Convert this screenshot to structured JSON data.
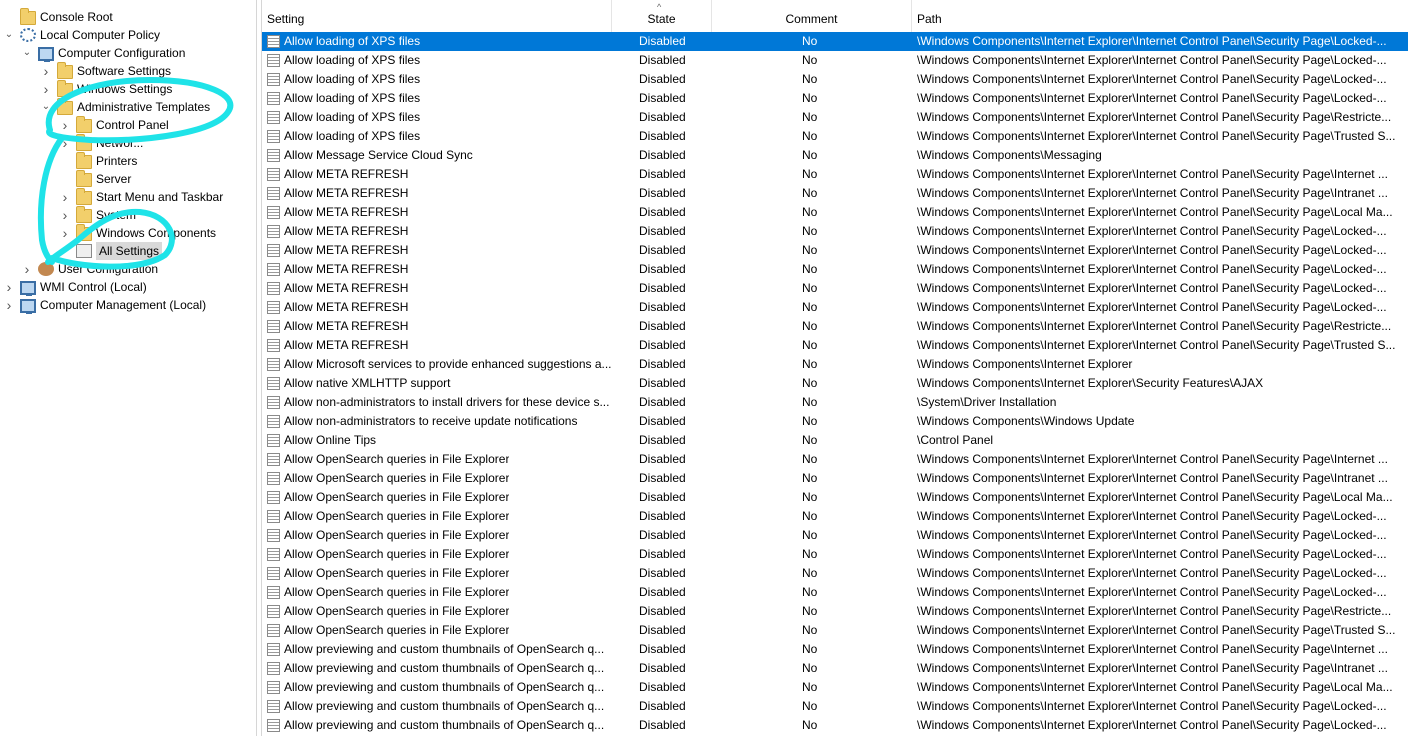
{
  "tree": {
    "nodes": [
      {
        "label": "Console Root",
        "icon": "folder-icon",
        "expand": ""
      },
      {
        "label": "Local Computer Policy",
        "icon": "gear-icon",
        "expand": "v"
      },
      {
        "label": "Computer Configuration",
        "icon": "computer-icon",
        "expand": "v"
      },
      {
        "label": "Software Settings",
        "icon": "folder-icon",
        "expand": ">"
      },
      {
        "label": "Windows Settings",
        "icon": "folder-icon",
        "expand": ">"
      },
      {
        "label": "Administrative Templates",
        "icon": "folder-icon",
        "expand": "v"
      },
      {
        "label": "Control Panel",
        "icon": "folder-icon",
        "expand": ">"
      },
      {
        "label": "Networ...",
        "icon": "folder-icon",
        "expand": ">"
      },
      {
        "label": "Printers",
        "icon": "folder-icon",
        "expand": ""
      },
      {
        "label": "Server",
        "icon": "folder-icon",
        "expand": ""
      },
      {
        "label": "Start Menu and Taskbar",
        "icon": "folder-icon",
        "expand": ">"
      },
      {
        "label": "System",
        "icon": "folder-icon",
        "expand": ">"
      },
      {
        "label": "Windows Components",
        "icon": "folder-icon",
        "expand": ">"
      },
      {
        "label": "All Settings",
        "icon": "settings-icon",
        "expand": ""
      },
      {
        "label": "User Configuration",
        "icon": "user-icon",
        "expand": ">"
      },
      {
        "label": "WMI Control (Local)",
        "icon": "computer-icon",
        "expand": ">"
      },
      {
        "label": "Computer Management (Local)",
        "icon": "computer-icon",
        "expand": ">"
      }
    ]
  },
  "list": {
    "columns": {
      "setting": "Setting",
      "state": "State",
      "comment": "Comment",
      "path": "Path"
    },
    "rows": [
      {
        "setting": "Allow loading of XPS files",
        "state": "Disabled",
        "comment": "No",
        "path": "\\Windows Components\\Internet Explorer\\Internet Control Panel\\Security Page\\Locked-..."
      },
      {
        "setting": "Allow loading of XPS files",
        "state": "Disabled",
        "comment": "No",
        "path": "\\Windows Components\\Internet Explorer\\Internet Control Panel\\Security Page\\Locked-..."
      },
      {
        "setting": "Allow loading of XPS files",
        "state": "Disabled",
        "comment": "No",
        "path": "\\Windows Components\\Internet Explorer\\Internet Control Panel\\Security Page\\Locked-..."
      },
      {
        "setting": "Allow loading of XPS files",
        "state": "Disabled",
        "comment": "No",
        "path": "\\Windows Components\\Internet Explorer\\Internet Control Panel\\Security Page\\Locked-..."
      },
      {
        "setting": "Allow loading of XPS files",
        "state": "Disabled",
        "comment": "No",
        "path": "\\Windows Components\\Internet Explorer\\Internet Control Panel\\Security Page\\Restricte..."
      },
      {
        "setting": "Allow loading of XPS files",
        "state": "Disabled",
        "comment": "No",
        "path": "\\Windows Components\\Internet Explorer\\Internet Control Panel\\Security Page\\Trusted S..."
      },
      {
        "setting": "Allow Message Service Cloud Sync",
        "state": "Disabled",
        "comment": "No",
        "path": "\\Windows Components\\Messaging"
      },
      {
        "setting": "Allow META REFRESH",
        "state": "Disabled",
        "comment": "No",
        "path": "\\Windows Components\\Internet Explorer\\Internet Control Panel\\Security Page\\Internet ..."
      },
      {
        "setting": "Allow META REFRESH",
        "state": "Disabled",
        "comment": "No",
        "path": "\\Windows Components\\Internet Explorer\\Internet Control Panel\\Security Page\\Intranet ..."
      },
      {
        "setting": "Allow META REFRESH",
        "state": "Disabled",
        "comment": "No",
        "path": "\\Windows Components\\Internet Explorer\\Internet Control Panel\\Security Page\\Local Ma..."
      },
      {
        "setting": "Allow META REFRESH",
        "state": "Disabled",
        "comment": "No",
        "path": "\\Windows Components\\Internet Explorer\\Internet Control Panel\\Security Page\\Locked-..."
      },
      {
        "setting": "Allow META REFRESH",
        "state": "Disabled",
        "comment": "No",
        "path": "\\Windows Components\\Internet Explorer\\Internet Control Panel\\Security Page\\Locked-..."
      },
      {
        "setting": "Allow META REFRESH",
        "state": "Disabled",
        "comment": "No",
        "path": "\\Windows Components\\Internet Explorer\\Internet Control Panel\\Security Page\\Locked-..."
      },
      {
        "setting": "Allow META REFRESH",
        "state": "Disabled",
        "comment": "No",
        "path": "\\Windows Components\\Internet Explorer\\Internet Control Panel\\Security Page\\Locked-..."
      },
      {
        "setting": "Allow META REFRESH",
        "state": "Disabled",
        "comment": "No",
        "path": "\\Windows Components\\Internet Explorer\\Internet Control Panel\\Security Page\\Locked-..."
      },
      {
        "setting": "Allow META REFRESH",
        "state": "Disabled",
        "comment": "No",
        "path": "\\Windows Components\\Internet Explorer\\Internet Control Panel\\Security Page\\Restricte..."
      },
      {
        "setting": "Allow META REFRESH",
        "state": "Disabled",
        "comment": "No",
        "path": "\\Windows Components\\Internet Explorer\\Internet Control Panel\\Security Page\\Trusted S..."
      },
      {
        "setting": "Allow Microsoft services to provide enhanced suggestions a...",
        "state": "Disabled",
        "comment": "No",
        "path": "\\Windows Components\\Internet Explorer"
      },
      {
        "setting": "Allow native XMLHTTP support",
        "state": "Disabled",
        "comment": "No",
        "path": "\\Windows Components\\Internet Explorer\\Security Features\\AJAX"
      },
      {
        "setting": "Allow non-administrators to install drivers for these device s...",
        "state": "Disabled",
        "comment": "No",
        "path": "\\System\\Driver Installation"
      },
      {
        "setting": "Allow non-administrators to receive update notifications",
        "state": "Disabled",
        "comment": "No",
        "path": "\\Windows Components\\Windows Update"
      },
      {
        "setting": "Allow Online Tips",
        "state": "Disabled",
        "comment": "No",
        "path": "\\Control Panel"
      },
      {
        "setting": "Allow OpenSearch queries in File Explorer",
        "state": "Disabled",
        "comment": "No",
        "path": "\\Windows Components\\Internet Explorer\\Internet Control Panel\\Security Page\\Internet ..."
      },
      {
        "setting": "Allow OpenSearch queries in File Explorer",
        "state": "Disabled",
        "comment": "No",
        "path": "\\Windows Components\\Internet Explorer\\Internet Control Panel\\Security Page\\Intranet ..."
      },
      {
        "setting": "Allow OpenSearch queries in File Explorer",
        "state": "Disabled",
        "comment": "No",
        "path": "\\Windows Components\\Internet Explorer\\Internet Control Panel\\Security Page\\Local Ma..."
      },
      {
        "setting": "Allow OpenSearch queries in File Explorer",
        "state": "Disabled",
        "comment": "No",
        "path": "\\Windows Components\\Internet Explorer\\Internet Control Panel\\Security Page\\Locked-..."
      },
      {
        "setting": "Allow OpenSearch queries in File Explorer",
        "state": "Disabled",
        "comment": "No",
        "path": "\\Windows Components\\Internet Explorer\\Internet Control Panel\\Security Page\\Locked-..."
      },
      {
        "setting": "Allow OpenSearch queries in File Explorer",
        "state": "Disabled",
        "comment": "No",
        "path": "\\Windows Components\\Internet Explorer\\Internet Control Panel\\Security Page\\Locked-..."
      },
      {
        "setting": "Allow OpenSearch queries in File Explorer",
        "state": "Disabled",
        "comment": "No",
        "path": "\\Windows Components\\Internet Explorer\\Internet Control Panel\\Security Page\\Locked-..."
      },
      {
        "setting": "Allow OpenSearch queries in File Explorer",
        "state": "Disabled",
        "comment": "No",
        "path": "\\Windows Components\\Internet Explorer\\Internet Control Panel\\Security Page\\Locked-..."
      },
      {
        "setting": "Allow OpenSearch queries in File Explorer",
        "state": "Disabled",
        "comment": "No",
        "path": "\\Windows Components\\Internet Explorer\\Internet Control Panel\\Security Page\\Restricte..."
      },
      {
        "setting": "Allow OpenSearch queries in File Explorer",
        "state": "Disabled",
        "comment": "No",
        "path": "\\Windows Components\\Internet Explorer\\Internet Control Panel\\Security Page\\Trusted S..."
      },
      {
        "setting": "Allow previewing and custom thumbnails of OpenSearch q...",
        "state": "Disabled",
        "comment": "No",
        "path": "\\Windows Components\\Internet Explorer\\Internet Control Panel\\Security Page\\Internet ..."
      },
      {
        "setting": "Allow previewing and custom thumbnails of OpenSearch q...",
        "state": "Disabled",
        "comment": "No",
        "path": "\\Windows Components\\Internet Explorer\\Internet Control Panel\\Security Page\\Intranet ..."
      },
      {
        "setting": "Allow previewing and custom thumbnails of OpenSearch q...",
        "state": "Disabled",
        "comment": "No",
        "path": "\\Windows Components\\Internet Explorer\\Internet Control Panel\\Security Page\\Local Ma..."
      },
      {
        "setting": "Allow previewing and custom thumbnails of OpenSearch q...",
        "state": "Disabled",
        "comment": "No",
        "path": "\\Windows Components\\Internet Explorer\\Internet Control Panel\\Security Page\\Locked-..."
      },
      {
        "setting": "Allow previewing and custom thumbnails of OpenSearch q...",
        "state": "Disabled",
        "comment": "No",
        "path": "\\Windows Components\\Internet Explorer\\Internet Control Panel\\Security Page\\Locked-..."
      }
    ]
  },
  "colors": {
    "selection": "#0078d7",
    "annotation": "#1fe3e8"
  }
}
